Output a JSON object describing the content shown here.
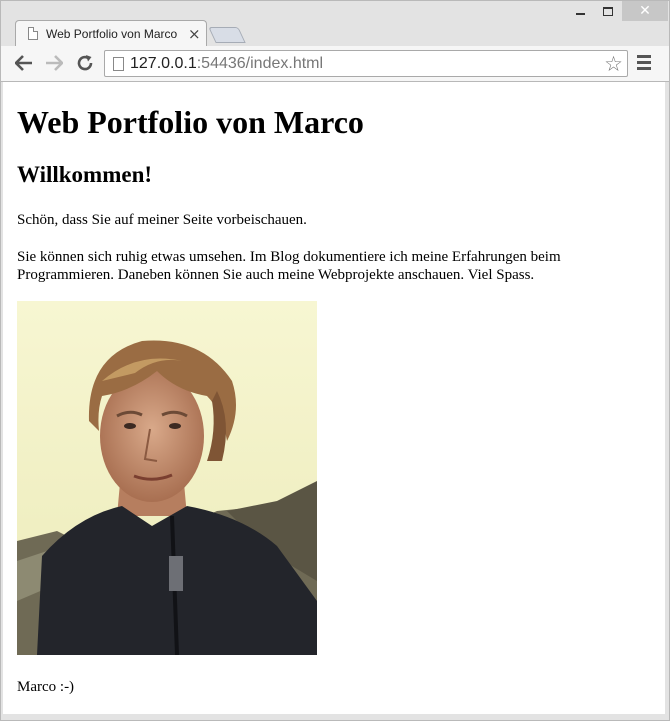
{
  "browser": {
    "tab_title": "Web Portfolio von Marco",
    "tab_close_glyph": "×",
    "url_host": "127.0.0.1",
    "url_rest": ":54436/index.html"
  },
  "page": {
    "heading": "Web Portfolio von Marco",
    "subheading": "Willkommen!",
    "intro": "Schön, dass Sie auf meiner Seite vorbeischauen.",
    "body": "Sie können sich ruhig etwas umsehen. Im Blog dokumentiere ich meine Erfahrungen beim Programmieren. Daneben können Sie auch meine Webprojekte anschauen. Viel Spass.",
    "signature": "Marco :-)"
  },
  "icons": {
    "back": "arrow-left",
    "forward": "arrow-right",
    "reload": "reload",
    "bookmark": "star-outline",
    "menu": "hamburger"
  },
  "colors": {
    "chrome": "#e3e3e3",
    "close_button": "#c7c7c7"
  }
}
